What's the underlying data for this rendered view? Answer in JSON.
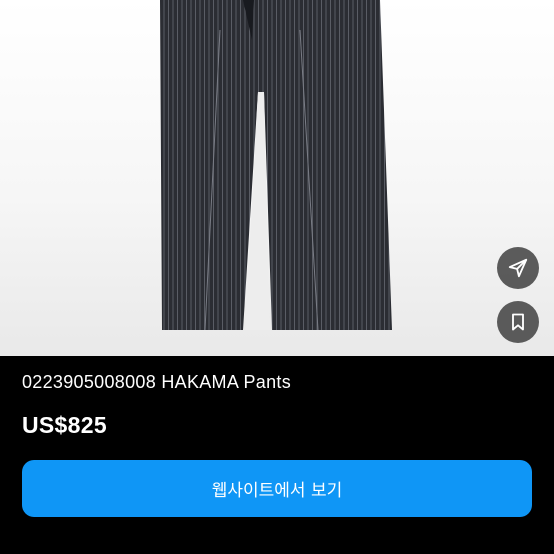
{
  "product": {
    "title": "0223905008008 HAKAMA Pants",
    "price": "US$825"
  },
  "actions": {
    "share_icon": "send-icon",
    "bookmark_icon": "bookmark-icon",
    "view_website_label": "웹사이트에서 보기"
  },
  "colors": {
    "background": "#000000",
    "cta": "#0f96f6",
    "fab": "#464646",
    "pants": "#2b2d33"
  }
}
